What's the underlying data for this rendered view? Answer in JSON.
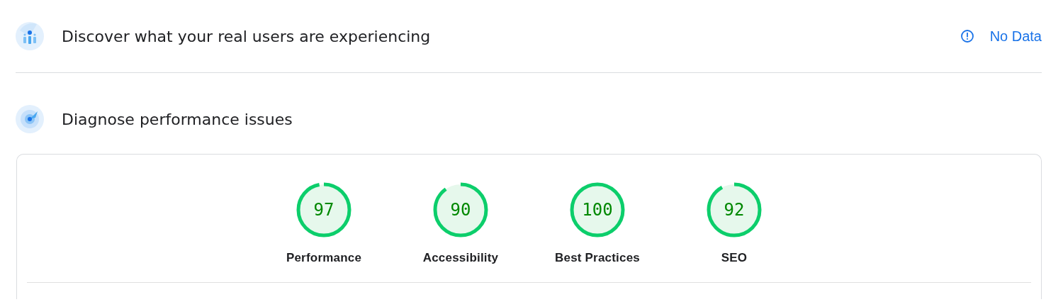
{
  "sections": [
    {
      "title": "Discover what your real users are experiencing",
      "status": {
        "label": "No Data"
      }
    },
    {
      "title": "Diagnose performance issues",
      "gauges": [
        {
          "score": "97",
          "level": 0.97,
          "label": "Performance"
        },
        {
          "score": "90",
          "level": 0.9,
          "label": "Accessibility"
        },
        {
          "score": "100",
          "level": 1,
          "label": "Best Practices"
        },
        {
          "score": "92",
          "level": 0.92,
          "label": "SEO"
        }
      ]
    }
  ]
}
